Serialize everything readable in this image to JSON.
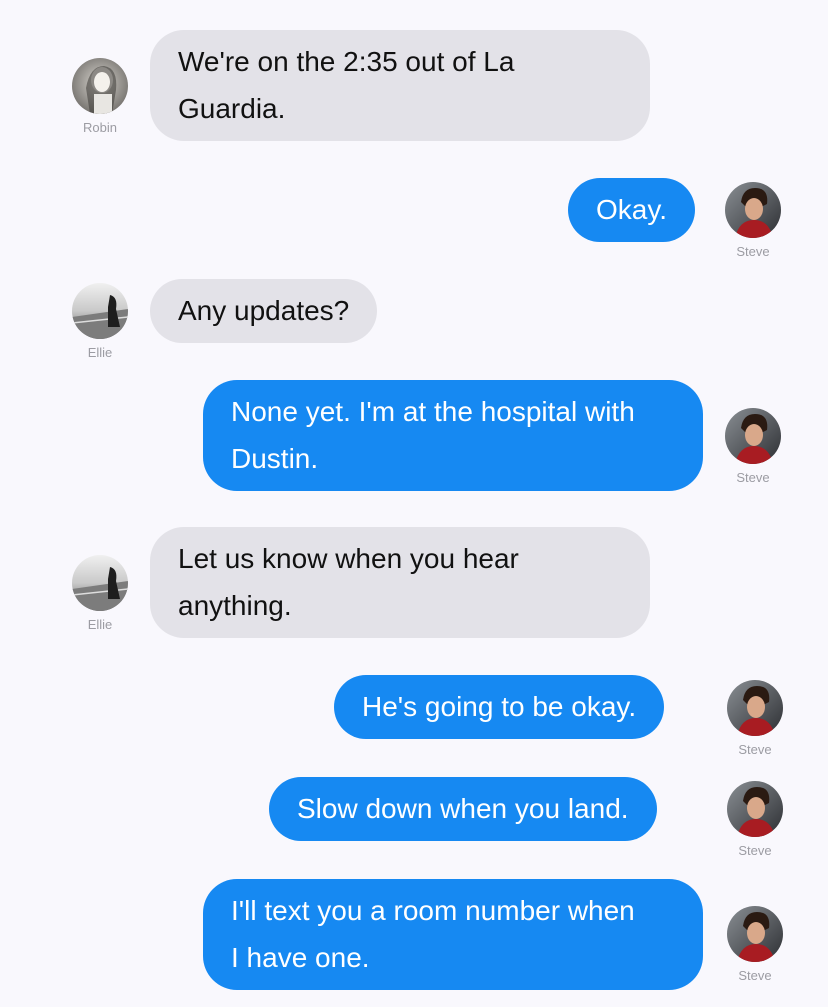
{
  "messages": [
    {
      "sender": "Robin",
      "direction": "incoming",
      "lines": [
        "We're on the 2:35 out of La",
        "Guardia."
      ],
      "avatar_icon": "robin-avatar-photo"
    },
    {
      "sender": "Steve",
      "direction": "outgoing",
      "lines": [
        "Okay."
      ],
      "avatar_icon": "steve-avatar-photo"
    },
    {
      "sender": "Ellie",
      "direction": "incoming",
      "lines": [
        "Any updates?"
      ],
      "avatar_icon": "ellie-avatar-photo"
    },
    {
      "sender": "Steve",
      "direction": "outgoing",
      "lines": [
        "None yet. I'm at the hospital with",
        "Dustin."
      ],
      "avatar_icon": "steve-avatar-photo"
    },
    {
      "sender": "Ellie",
      "direction": "incoming",
      "lines": [
        "Let us know when you hear",
        "anything."
      ],
      "avatar_icon": "ellie-avatar-photo"
    },
    {
      "sender": "Steve",
      "direction": "outgoing",
      "lines": [
        "He's going to be okay."
      ],
      "avatar_icon": "steve-avatar-photo"
    },
    {
      "sender": "Steve",
      "direction": "outgoing",
      "lines": [
        "Slow down when you land."
      ],
      "avatar_icon": "steve-avatar-photo"
    },
    {
      "sender": "Steve",
      "direction": "outgoing",
      "lines": [
        "I'll text you a room number when",
        "I have one."
      ],
      "avatar_icon": "steve-avatar-photo"
    }
  ],
  "colors": {
    "background": "#f9f8fd",
    "incoming_bubble": "#e3e2e8",
    "outgoing_bubble": "#1689f2",
    "outgoing_text": "#ffffff",
    "incoming_text": "#111111",
    "name_label": "#9c9ca3"
  }
}
